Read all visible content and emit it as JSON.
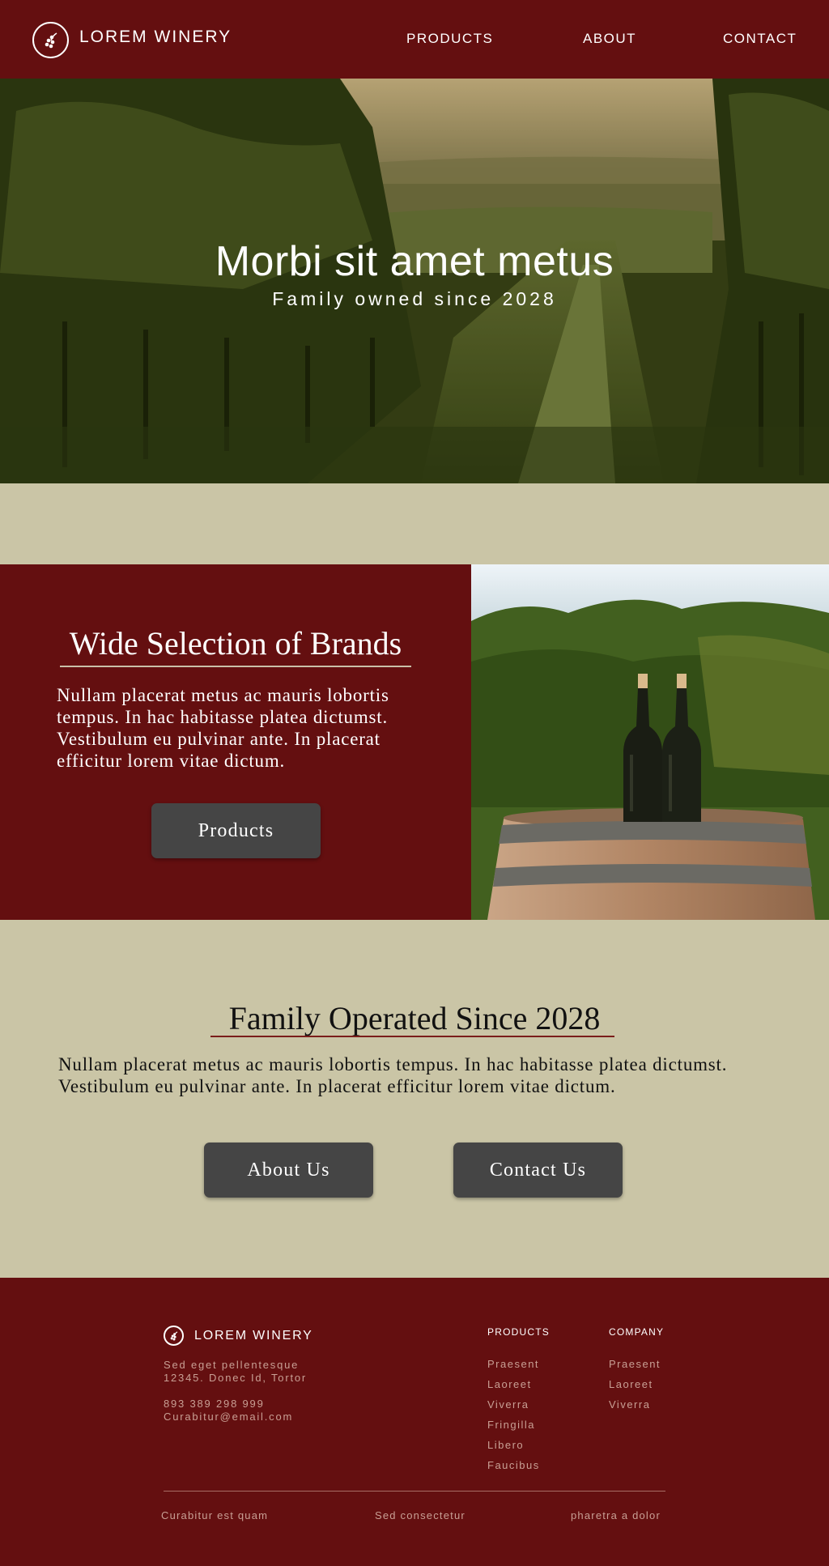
{
  "header": {
    "brand": "LOREM WINERY",
    "nav": [
      "PRODUCTS",
      "ABOUT",
      "CONTACT"
    ]
  },
  "hero": {
    "title": "Morbi sit amet metus",
    "subtitle": "Family owned since 2028"
  },
  "brands": {
    "title": "Wide Selection of Brands",
    "text": "Nullam placerat metus ac mauris lobortis tempus. In hac habitasse platea dictumst. Vestibulum eu pulvinar ante. In placerat efficitur lorem vitae dictum.",
    "button": "Products"
  },
  "family": {
    "title": "Family Operated Since 2028",
    "text": "Nullam placerat metus ac mauris lobortis tempus. In hac habitasse platea dictumst. Vestibulum eu pulvinar ante. In placerat efficitur lorem vitae dictum.",
    "about_button": "About Us",
    "contact_button": "Contact Us"
  },
  "footer": {
    "brand": "LOREM WINERY",
    "address_line1": "Sed eget pellentesque",
    "address_line2": "12345. Donec Id, Tortor",
    "phone": "893 389 298 999",
    "email": "Curabitur@email.com",
    "products_heading": "PRODUCTS",
    "products": [
      "Praesent",
      "Laoreet",
      "Viverra",
      "Fringilla",
      "Libero",
      "Faucibus"
    ],
    "company_heading": "COMPANY",
    "company": [
      "Praesent",
      "Laoreet",
      "Viverra"
    ],
    "bottom_links": [
      "Curabitur est quam",
      "Sed consectetur",
      "pharetra a dolor"
    ]
  },
  "colors": {
    "primary": "#640f10",
    "background": "#cac5a6",
    "button": "#454545",
    "footer_text": "#c89f94"
  }
}
